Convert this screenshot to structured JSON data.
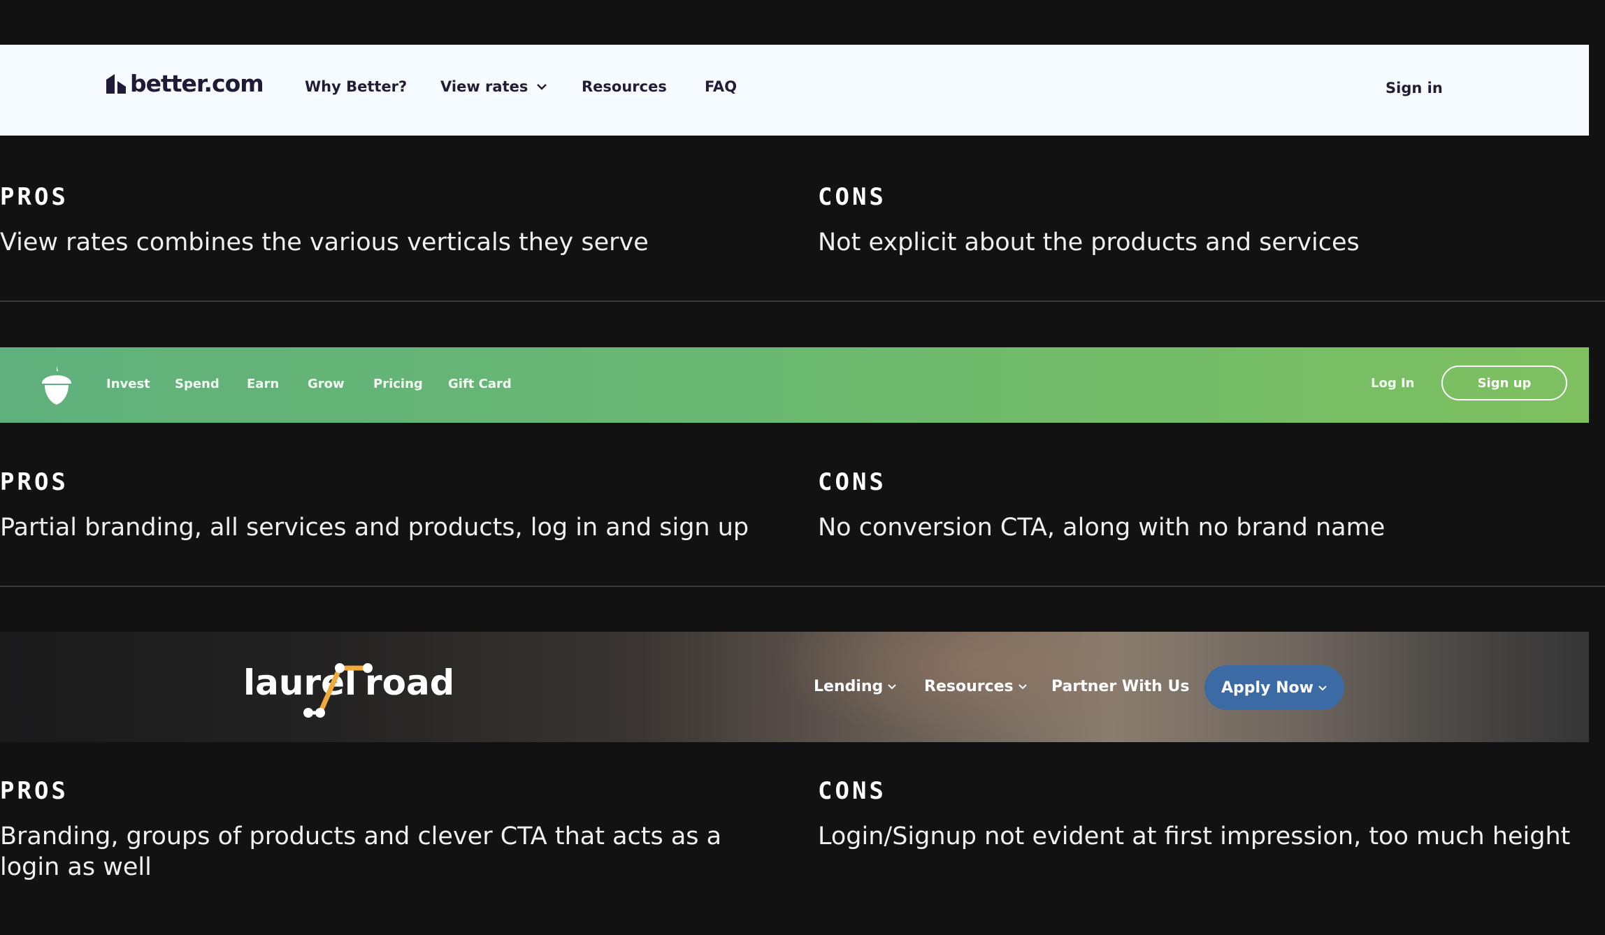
{
  "better": {
    "logo_text": "better.com",
    "nav": [
      "Why Better?",
      "View rates",
      "Resources",
      "FAQ"
    ],
    "sign_in": "Sign in"
  },
  "section1": {
    "pros_label": "PROS",
    "pros_text": "View rates combines the various verticals they serve",
    "cons_label": "CONS",
    "cons_text": "Not explicit about the products and services"
  },
  "acorns": {
    "nav": [
      "Invest",
      "Spend",
      "Earn",
      "Grow",
      "Pricing",
      "Gift Card"
    ],
    "log_in": "Log In",
    "sign_up": "Sign up"
  },
  "section2": {
    "pros_label": "PROS",
    "pros_text": "Partial branding, all services and products, log in and sign up",
    "cons_label": "CONS",
    "cons_text": "No conversion CTA, along with no brand name"
  },
  "laurel": {
    "logo_word1": "laurel",
    "logo_word2": "road",
    "nav": [
      "Lending",
      "Resources",
      "Partner With Us"
    ],
    "apply": "Apply Now"
  },
  "section3": {
    "pros_label": "PROS",
    "pros_text": "Branding, groups of products and clever CTA that acts as a login as well",
    "cons_label": "CONS",
    "cons_text": "Login/Signup not evident at first impression, too much height"
  },
  "colors": {
    "background": "#121212",
    "better_bar": "#f5fbff",
    "acorns_green_start": "#5fb07d",
    "acorns_green_end": "#7ec060",
    "laurel_button": "#3b6aa5",
    "laurel_accent": "#f0a93b"
  }
}
